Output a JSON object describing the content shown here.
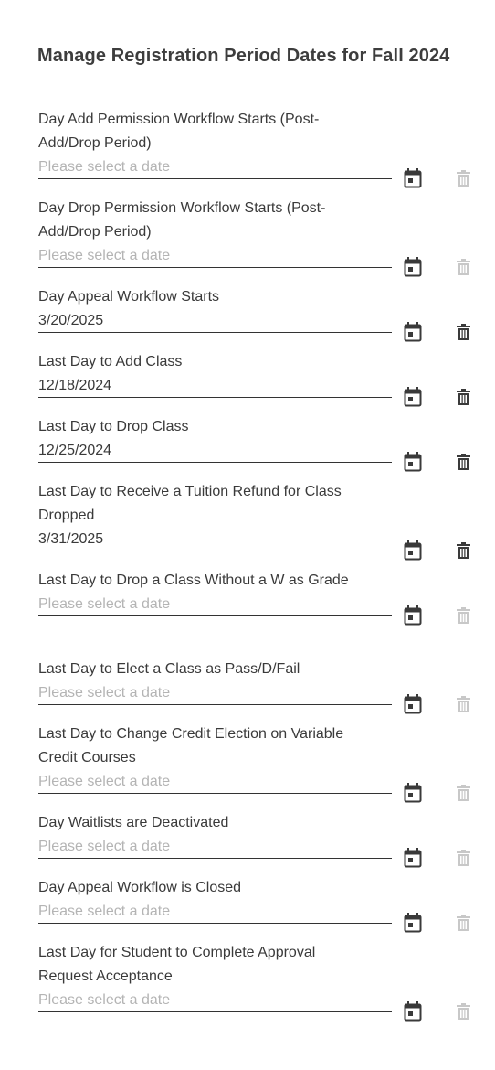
{
  "title": "Manage Registration Period Dates for Fall 2024",
  "placeholder": "Please select a date",
  "icons": {
    "calendar": "calendar-icon",
    "delete": "trash-icon"
  },
  "colors": {
    "active_icon": "#3a3a3a",
    "disabled_icon": "#c8c8c8",
    "placeholder_text": "#b4b4b4"
  },
  "fields": [
    {
      "label": "Day Add Permission Workflow Starts (Post-Add/Drop Period)",
      "value": ""
    },
    {
      "label": "Day Drop Permission Workflow Starts (Post-Add/Drop Period)",
      "value": ""
    },
    {
      "label": "Day Appeal Workflow Starts",
      "value": "3/20/2025"
    },
    {
      "label": "Last Day to Add Class",
      "value": "12/18/2024"
    },
    {
      "label": "Last Day to Drop Class",
      "value": "12/25/2024"
    },
    {
      "label": "Last Day to Receive a Tuition Refund for Class Dropped",
      "value": "3/31/2025"
    },
    {
      "label": "Last Day to Drop a Class Without a W as Grade",
      "value": ""
    },
    {
      "label": "Last Day to Elect a Class as Pass/D/Fail",
      "value": ""
    },
    {
      "label": "Last Day to Change Credit Election on Variable Credit Courses",
      "value": ""
    },
    {
      "label": "Day Waitlists are Deactivated",
      "value": ""
    },
    {
      "label": "Day Appeal Workflow is Closed",
      "value": ""
    },
    {
      "label": "Last Day for Student to Complete Approval Request Acceptance",
      "value": ""
    }
  ]
}
